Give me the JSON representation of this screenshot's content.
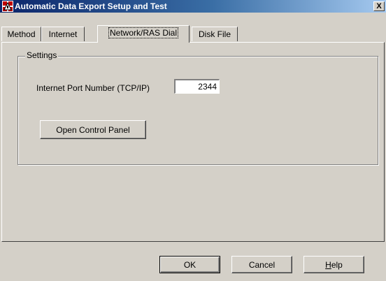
{
  "window": {
    "title": "Automatic Data Export Setup and Test",
    "close_label": "X",
    "title_gradient_start": "#0a246a",
    "title_gradient_end": "#a6caf0",
    "face_color": "#d4d0c8"
  },
  "tabs": [
    {
      "label": "Method",
      "active": false
    },
    {
      "label": "Internet",
      "active": false
    },
    {
      "label": "Network/RAS Dial",
      "active": true
    },
    {
      "label": "Disk File",
      "active": false
    }
  ],
  "settings": {
    "group_label": "Settings",
    "port_label": "Internet Port Number (TCP/IP)",
    "port_value": "2344",
    "open_control_panel_label": "Open Control Panel"
  },
  "footer": {
    "ok_label": "OK",
    "cancel_label": "Cancel",
    "help_label_prefix": "H",
    "help_label_rest": "elp"
  },
  "icons": {
    "app": "app-icon",
    "close": "close-icon"
  }
}
